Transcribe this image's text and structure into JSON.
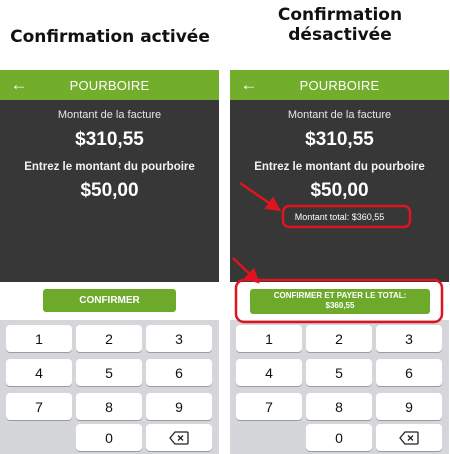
{
  "headings": {
    "left": "Confirmation activée",
    "right_line1": "Confirmation",
    "right_line2": "désactivée"
  },
  "colors": {
    "appbar": "#72ad2c",
    "button": "#6daa2c",
    "dark_panel": "#373737",
    "keypad": "#d5d6da",
    "highlight": "#e0141e"
  },
  "screens": {
    "left": {
      "appbar": {
        "back_icon": "arrow-left-icon",
        "title": "POURBOIRE"
      },
      "invoice_label": "Montant de la facture",
      "invoice_amount": "$310,55",
      "tip_label": "Entrez le montant du pourboire",
      "tip_amount": "$50,00",
      "confirm_button": "CONFIRMER",
      "keypad": [
        "1",
        "2",
        "3",
        "4",
        "5",
        "6",
        "7",
        "8",
        "9",
        "0"
      ],
      "backspace_icon": "backspace-icon"
    },
    "right": {
      "appbar": {
        "back_icon": "arrow-left-icon",
        "title": "POURBOIRE"
      },
      "invoice_label": "Montant de la facture",
      "invoice_amount": "$310,55",
      "tip_label": "Entrez le montant du pourboire",
      "tip_amount": "$50,00",
      "total_text": "Montant total: $360,55",
      "confirm_button_line1": "CONFIRMER ET PAYER LE TOTAL:",
      "confirm_button_line2": "$360,55",
      "keypad": [
        "1",
        "2",
        "3",
        "4",
        "5",
        "6",
        "7",
        "8",
        "9",
        "0"
      ],
      "backspace_icon": "backspace-icon"
    }
  }
}
